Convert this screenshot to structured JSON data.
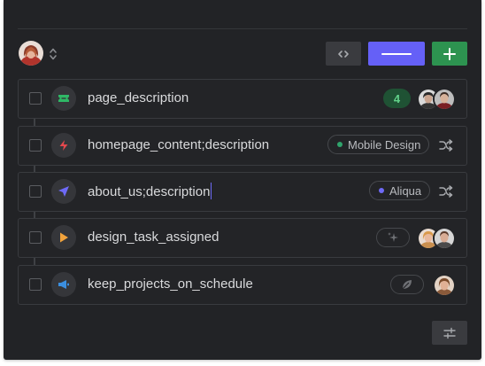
{
  "header": {
    "avatar_icon": "user-avatar",
    "sort_icon": "sort-up-down-icon",
    "buttons": {
      "code_icon": "code-brackets-icon",
      "primary_icon": "minus-line-icon",
      "add_icon": "plus-icon"
    },
    "colors": {
      "primary": "#6560f7",
      "add": "#2d9350"
    }
  },
  "tasks": [
    {
      "title": "page_description",
      "icon": "ticket-icon",
      "icon_color": "#2fb866",
      "count": "4"
    },
    {
      "title": "homepage_content;description",
      "icon": "bolt-icon",
      "icon_color": "#e5484d",
      "tag": "Mobile Design",
      "tag_color": "#30a46c",
      "action_icon": "shuffle-icon"
    },
    {
      "title": "about_us;description",
      "icon": "send-icon",
      "icon_color": "#6e6af7",
      "tag": "Aliqua",
      "tag_color": "#6e6af7",
      "action_icon": "shuffle-icon",
      "editing": true
    },
    {
      "title": "design_task_assigned",
      "icon": "play-icon",
      "icon_color": "#f1a33c",
      "pill_icon": "sparkle-icon"
    },
    {
      "title": "keep_projects_on_schedule",
      "icon": "megaphone-icon",
      "icon_color": "#3b8fe0",
      "pill_icon": "leaf-icon"
    }
  ],
  "footer": {
    "settings_icon": "sliders-icon"
  }
}
